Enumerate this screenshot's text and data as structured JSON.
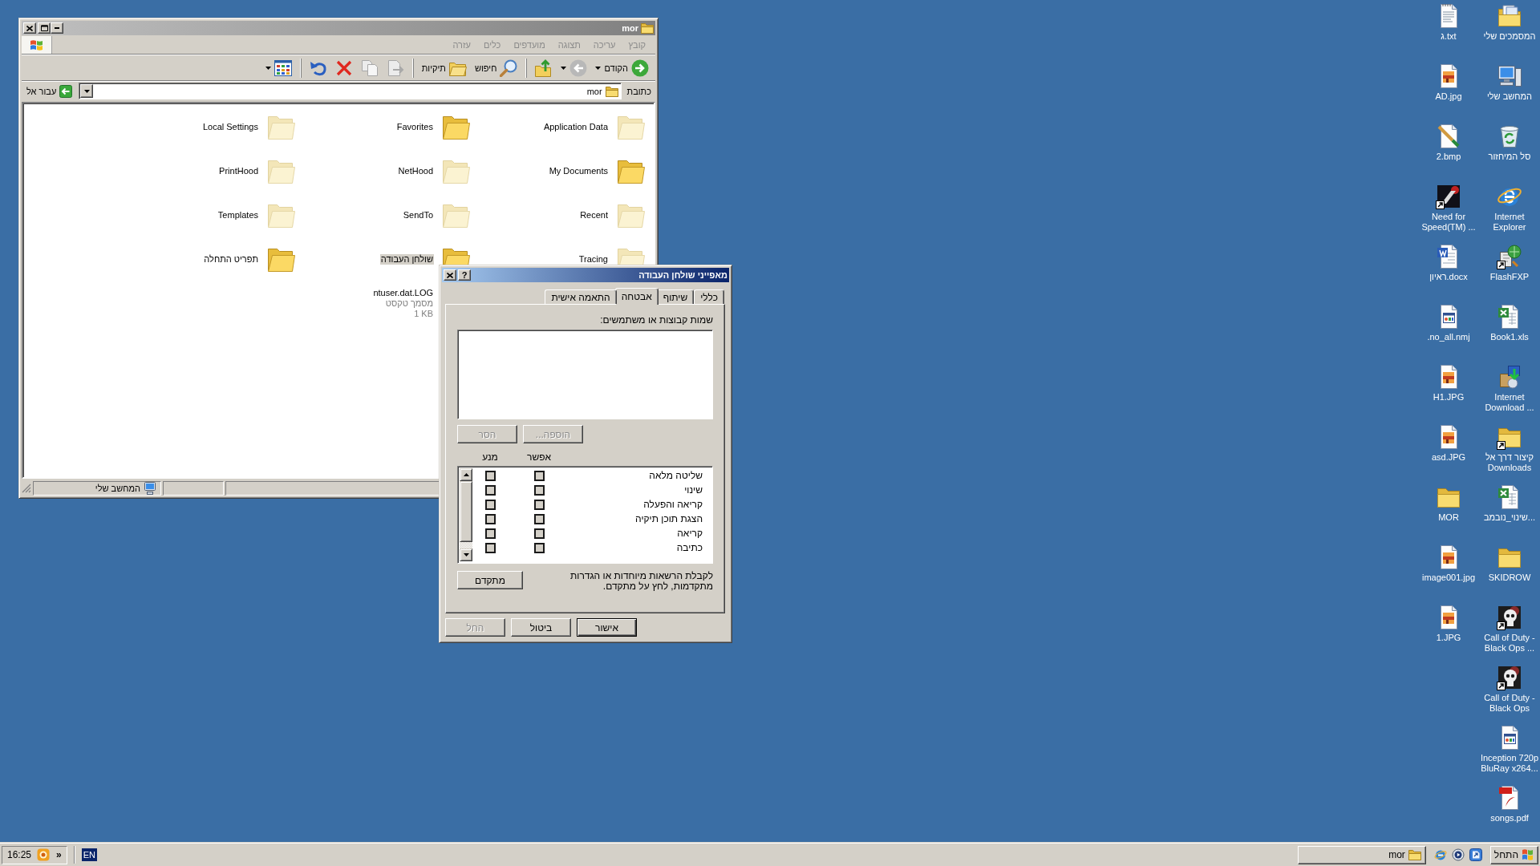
{
  "desktop": {
    "icons": [
      {
        "label": "המסמכים שלי",
        "kind": "documents",
        "shortcut": false
      },
      {
        "label": "המחשב שלי",
        "kind": "computer",
        "shortcut": false
      },
      {
        "label": "סל המיחזור",
        "kind": "recycle",
        "shortcut": false
      },
      {
        "label": "Internet Explorer",
        "kind": "ie",
        "shortcut": false
      },
      {
        "label": "FlashFXP",
        "kind": "flashfxp",
        "shortcut": true
      },
      {
        "label": "Book1.xls",
        "kind": "excel",
        "shortcut": false
      },
      {
        "label": "Internet Download ...",
        "kind": "installer",
        "shortcut": false
      },
      {
        "label": "קיצור דרך אל Downloads",
        "kind": "folder",
        "shortcut": true
      },
      {
        "label": "שינוי_נובמב...",
        "kind": "excel",
        "shortcut": false
      },
      {
        "label": "SKIDROW",
        "kind": "folder",
        "shortcut": false
      },
      {
        "label": "Call of Duty - Black Ops ...",
        "kind": "game",
        "shortcut": true
      },
      {
        "label": "Call of Duty - Black Ops",
        "kind": "game",
        "shortcut": true
      },
      {
        "label": "Inception 720p BluRay x264...",
        "kind": "media",
        "shortcut": false
      },
      {
        "label": "songs.pdf",
        "kind": "pdf",
        "shortcut": false
      },
      {
        "label": "ג.txt",
        "kind": "text",
        "shortcut": false
      },
      {
        "label": "AD.jpg",
        "kind": "image",
        "shortcut": false
      },
      {
        "label": "2.bmp",
        "kind": "paint",
        "shortcut": false
      },
      {
        "label": "Need for Speed(TM) ...",
        "kind": "racing",
        "shortcut": true
      },
      {
        "label": "ראיון.docx",
        "kind": "word",
        "shortcut": false
      },
      {
        "label": ".no_all.nmj",
        "kind": "media",
        "shortcut": false
      },
      {
        "label": "H1.JPG",
        "kind": "image",
        "shortcut": false
      },
      {
        "label": "asd.JPG",
        "kind": "image",
        "shortcut": false
      },
      {
        "label": "MOR",
        "kind": "folder",
        "shortcut": false
      },
      {
        "label": "image001.jpg",
        "kind": "image",
        "shortcut": false
      },
      {
        "label": "1.JPG",
        "kind": "image",
        "shortcut": false
      }
    ]
  },
  "explorer": {
    "title": "mor",
    "active": false,
    "menu": [
      "קובץ",
      "עריכה",
      "תצוגה",
      "מועדפים",
      "כלים",
      "עזרה"
    ],
    "toolbar": [
      {
        "kind": "back",
        "label": "הקודם",
        "dropdown": true,
        "disabled": false
      },
      {
        "kind": "forward",
        "dropdown": true,
        "disabled": true
      },
      {
        "kind": "up",
        "dropdown": false,
        "disabled": false
      },
      {
        "kind": "separator"
      },
      {
        "kind": "search",
        "label": "חיפוש",
        "dropdown": false,
        "disabled": false
      },
      {
        "kind": "folders",
        "label": "תיקיות",
        "dropdown": false,
        "disabled": false
      },
      {
        "kind": "separator"
      },
      {
        "kind": "move",
        "dropdown": false,
        "disabled": true
      },
      {
        "kind": "copy",
        "dropdown": false,
        "disabled": true
      },
      {
        "kind": "delete",
        "dropdown": false,
        "disabled": false
      },
      {
        "kind": "undo",
        "dropdown": false,
        "disabled": false
      },
      {
        "kind": "separator"
      },
      {
        "kind": "views",
        "dropdown": true,
        "disabled": false
      }
    ],
    "address": {
      "label": "כתובת",
      "value": "mor",
      "go": "עבור אל"
    },
    "columns": [
      [
        {
          "name": "Application Data",
          "kind": "folder",
          "hidden": true,
          "selected": false
        },
        {
          "name": "My Documents",
          "kind": "folder",
          "hidden": false,
          "selected": false
        },
        {
          "name": "Recent",
          "kind": "folder",
          "hidden": true,
          "selected": false
        },
        {
          "name": "Tracing",
          "kind": "folder",
          "hidden": true,
          "selected": false
        }
      ],
      [
        {
          "name": "Favorites",
          "kind": "folder",
          "hidden": false,
          "selected": false
        },
        {
          "name": "NetHood",
          "kind": "folder",
          "hidden": true,
          "selected": false
        },
        {
          "name": "SendTo",
          "kind": "folder",
          "hidden": true,
          "selected": false
        },
        {
          "name": "שולחן העבודה",
          "kind": "folder",
          "hidden": false,
          "selected": true
        },
        {
          "name": "ntuser.dat.LOG",
          "kind": "file",
          "selected": false,
          "details": [
            "מסמך טקסט",
            "1 KB"
          ]
        }
      ],
      [
        {
          "name": "Local Settings",
          "kind": "folder",
          "hidden": true,
          "selected": false
        },
        {
          "name": "PrintHood",
          "kind": "folder",
          "hidden": true,
          "selected": false
        },
        {
          "name": "Templates",
          "kind": "folder",
          "hidden": true,
          "selected": false
        },
        {
          "name": "תפריט התחלה",
          "kind": "folder",
          "hidden": false,
          "selected": false
        }
      ]
    ],
    "status_bar": {
      "zone": "המחשב שלי"
    }
  },
  "dialog": {
    "title": "מאפייני שולחן העבודה",
    "active": true,
    "help": "?",
    "tabs": [
      {
        "label": "כללי",
        "selected": false
      },
      {
        "label": "שיתוף",
        "selected": false
      },
      {
        "label": "אבטחה",
        "selected": true
      },
      {
        "label": "התאמה אישית",
        "selected": false
      }
    ],
    "users_label": "שמות קבוצות או משתמשים:",
    "user_buttons": [
      {
        "label": "הוספה...",
        "disabled": true
      },
      {
        "label": "הסר",
        "disabled": true
      }
    ],
    "permission_columns": [
      "אפשר",
      "מנע"
    ],
    "permissions": [
      {
        "name": "שליטה מלאה",
        "allow": {
          "checked": false,
          "disabled": true
        },
        "deny": {
          "checked": false,
          "disabled": true
        }
      },
      {
        "name": "שינוי",
        "allow": {
          "checked": false,
          "disabled": true
        },
        "deny": {
          "checked": false,
          "disabled": true
        }
      },
      {
        "name": "קריאה והפעלה",
        "allow": {
          "checked": false,
          "disabled": true
        },
        "deny": {
          "checked": false,
          "disabled": true
        }
      },
      {
        "name": "הצגת תוכן תיקיה",
        "allow": {
          "checked": false,
          "disabled": true
        },
        "deny": {
          "checked": false,
          "disabled": true
        }
      },
      {
        "name": "קריאה",
        "allow": {
          "checked": false,
          "disabled": true
        },
        "deny": {
          "checked": false,
          "disabled": true
        }
      },
      {
        "name": "כתיבה",
        "allow": {
          "checked": false,
          "disabled": true
        },
        "deny": {
          "checked": false,
          "disabled": true
        }
      }
    ],
    "advanced_note": "לקבלת הרשאות מיוחדות או הגדרות מתקדמות, לחץ על מתקדם.",
    "advanced_button": "מתקדם",
    "buttons": [
      {
        "label": "אישור",
        "default": true,
        "disabled": false
      },
      {
        "label": "ביטול",
        "default": false,
        "disabled": false
      },
      {
        "label": "החל",
        "default": false,
        "disabled": true
      }
    ]
  },
  "taskbar": {
    "start": "התחל",
    "quick_launch": [
      {
        "kind": "desktop"
      },
      {
        "kind": "player"
      },
      {
        "kind": "browser"
      }
    ],
    "tasks": [
      {
        "label": "mor",
        "selected": false
      }
    ],
    "language": "EN",
    "tray": {
      "chevron": "»",
      "clock": "16:25"
    }
  }
}
